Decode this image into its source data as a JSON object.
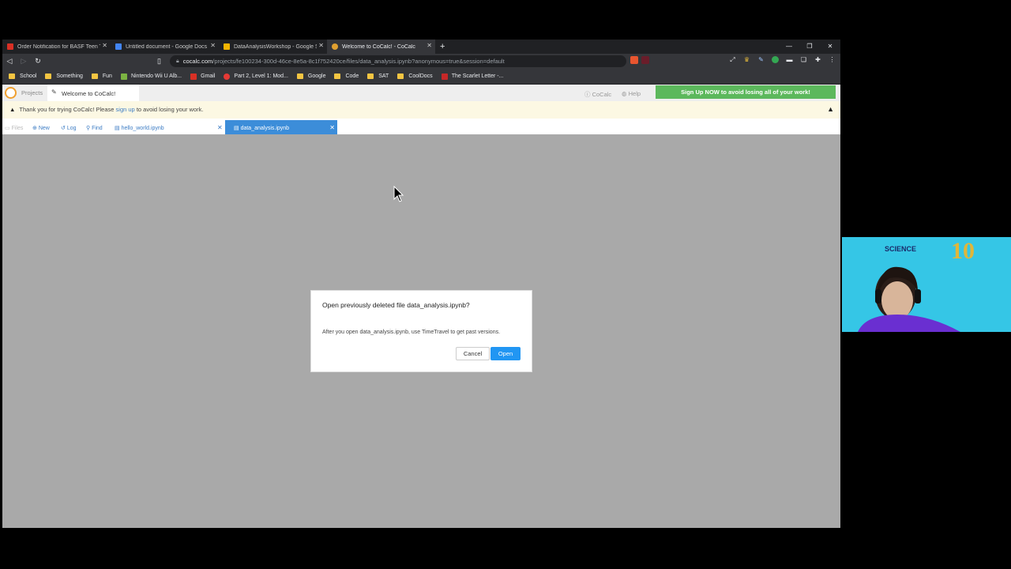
{
  "tabs": [
    {
      "title": "Order Notification for BASF Teen T",
      "favicon_color": "#d93025",
      "active": false
    },
    {
      "title": "Untitled document - Google Docs",
      "favicon_color": "#4285f4",
      "active": false
    },
    {
      "title": "DataAnalysisWorkshop - Google S",
      "favicon_color": "#f4b400",
      "active": false
    },
    {
      "title": "Welcome to CoCalc! - CoCalc",
      "favicon_color": "#e0a030",
      "active": true
    }
  ],
  "address": {
    "host": "cocalc.com",
    "path": "/projects/fe100234-300d-46ce-8e5a-8c1f752420ce/files/data_analysis.ipynb?anonymous=true&session=default"
  },
  "bookmarks": [
    {
      "label": "School",
      "type": "folder"
    },
    {
      "label": "Something",
      "type": "folder"
    },
    {
      "label": "Fun",
      "type": "folder"
    },
    {
      "label": "Nintendo Wii U Alb...",
      "type": "site",
      "color": "#7cb342"
    },
    {
      "label": "Gmail",
      "type": "site",
      "color": "#d93025"
    },
    {
      "label": "Part 2, Level 1: Mod...",
      "type": "site",
      "color": "#e53935"
    },
    {
      "label": "Google",
      "type": "folder"
    },
    {
      "label": "Code",
      "type": "folder"
    },
    {
      "label": "SAT",
      "type": "folder"
    },
    {
      "label": "CoolDocs",
      "type": "folder"
    },
    {
      "label": "The Scarlet Letter -...",
      "type": "site",
      "color": "#c62828"
    }
  ],
  "cocalc": {
    "projects_label": "Projects",
    "welcome_tab": "Welcome to CoCalc!",
    "cocalc_link": "CoCalc",
    "help_link": "Help",
    "signup_button": "Sign Up NOW to avoid losing all of your work!",
    "banner_prefix": "Thank you for trying CoCalc!  Please",
    "banner_link": "sign up",
    "banner_suffix": "to avoid losing your work.",
    "filebar": {
      "files": "Files",
      "new": "New",
      "log": "Log",
      "find": "Find",
      "file1": "hello_world.ipynb",
      "file2": "data_analysis.ipynb"
    }
  },
  "modal": {
    "title": "Open previously deleted file data_analysis.ipynb?",
    "body": "After you open data_analysis.ipynb, use TimeTravel to get past versions.",
    "cancel": "Cancel",
    "open": "Open"
  },
  "webcam": {
    "science_text": "SCIENCE",
    "ten_text": "10"
  }
}
